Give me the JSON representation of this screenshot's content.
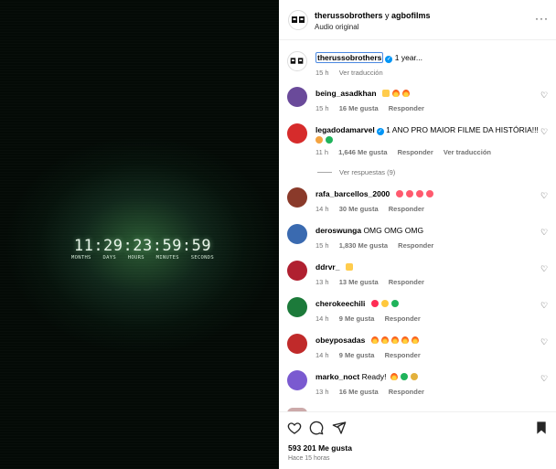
{
  "media": {
    "countdown_digits": "11:29:23:59:59",
    "unit_labels": [
      "MONTHS",
      "DAYS",
      "HOURS",
      "MINUTES",
      "SECONDS"
    ]
  },
  "header": {
    "author1": "therussobrothers",
    "joiner": "y",
    "author2": "agbofilms",
    "audio": "Audio original",
    "more_icon": "more-horizontal-icon"
  },
  "caption": {
    "user": "therussobrothers",
    "text": "1 year...",
    "time": "15 h",
    "translate": "Ver traducción"
  },
  "comments": [
    {
      "user": "being_asadkhan",
      "text": "",
      "emojis": [
        "raise",
        "fire",
        "fire"
      ],
      "time": "15 h",
      "likes": "16 Me gusta",
      "reply": "Responder",
      "extra": "",
      "avatar_color": "#6a4a9a"
    },
    {
      "user": "legadodamarvel",
      "verified": true,
      "text": "1 ANO PRO MAIOR FILME DA HISTÓRIA!!!",
      "emojis2": [
        "sob",
        "heart-green"
      ],
      "time": "11 h",
      "likes": "1,646 Me gusta",
      "reply": "Responder",
      "extra": "Ver traducción",
      "avatar_color": "#d62b2b"
    },
    {
      "user": "rafa_barcellos_2000",
      "text": "",
      "emojis": [
        "starstruck",
        "starstruck",
        "starstruck",
        "starstruck"
      ],
      "time": "14 h",
      "likes": "30 Me gusta",
      "reply": "Responder",
      "extra": "",
      "avatar_color": "#8a3a2a"
    },
    {
      "user": "deroswunga",
      "text": "OMG OMG OMG",
      "time": "15 h",
      "likes": "1,830 Me gusta",
      "reply": "Responder",
      "extra": "",
      "avatar_color": "#3a6ab0"
    },
    {
      "user": "ddrvr_",
      "text": "",
      "emojis": [
        "raise"
      ],
      "time": "13 h",
      "likes": "13 Me gusta",
      "reply": "Responder",
      "extra": "",
      "avatar_color": "#b02030"
    },
    {
      "user": "cherokeechili",
      "text": "",
      "emojis": [
        "heart-red",
        "heart-yellow",
        "heart-green"
      ],
      "time": "14 h",
      "likes": "9 Me gusta",
      "reply": "Responder",
      "extra": "",
      "avatar_color": "#1c7a3a"
    },
    {
      "user": "obeyposadas",
      "text": "",
      "emojis": [
        "fire",
        "fire",
        "fire",
        "fire",
        "fire"
      ],
      "time": "14 h",
      "likes": "9 Me gusta",
      "reply": "Responder",
      "extra": "",
      "avatar_color": "#c02a2a"
    },
    {
      "user": "marko_noct",
      "text": "Ready!",
      "emojis": [
        "fire",
        "heart-green",
        "think"
      ],
      "time": "13 h",
      "likes": "16 Me gusta",
      "reply": "Responder",
      "extra": "",
      "avatar_color": "#7a5ad0"
    }
  ],
  "replies_link": "Ver respuestas (9)",
  "footer": {
    "likes": "593 201 Me gusta",
    "time": "Hace 15 horas"
  }
}
